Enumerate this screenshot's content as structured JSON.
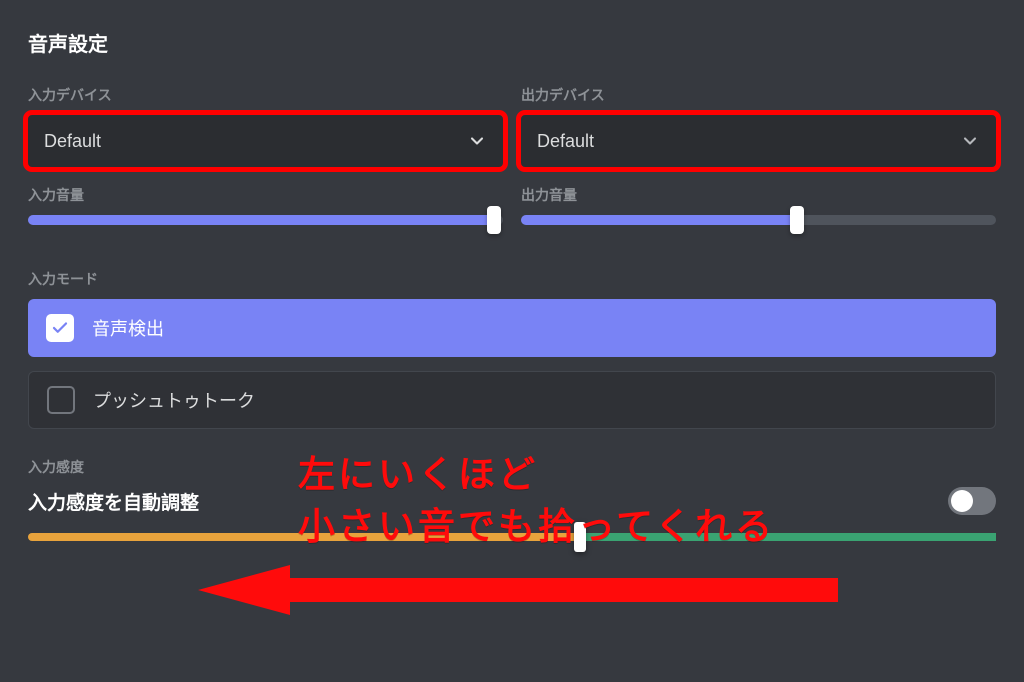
{
  "title": "音声設定",
  "inputDevice": {
    "label": "入力デバイス",
    "value": "Default"
  },
  "outputDevice": {
    "label": "出力デバイス",
    "value": "Default"
  },
  "inputVolume": {
    "label": "入力音量",
    "percent": 98
  },
  "outputVolume": {
    "label": "出力音量",
    "percent": 58
  },
  "inputMode": {
    "label": "入力モード",
    "voiceActivity": "音声検出",
    "pushToTalk": "プッシュトゥトーク"
  },
  "sensitivity": {
    "label": "入力感度",
    "autoLabel": "入力感度を自動調整",
    "autoEnabled": false,
    "thresholdPercent": 57
  },
  "annotation": {
    "line1": "左にいくほど",
    "line2": "小さい音でも拾ってくれる"
  }
}
